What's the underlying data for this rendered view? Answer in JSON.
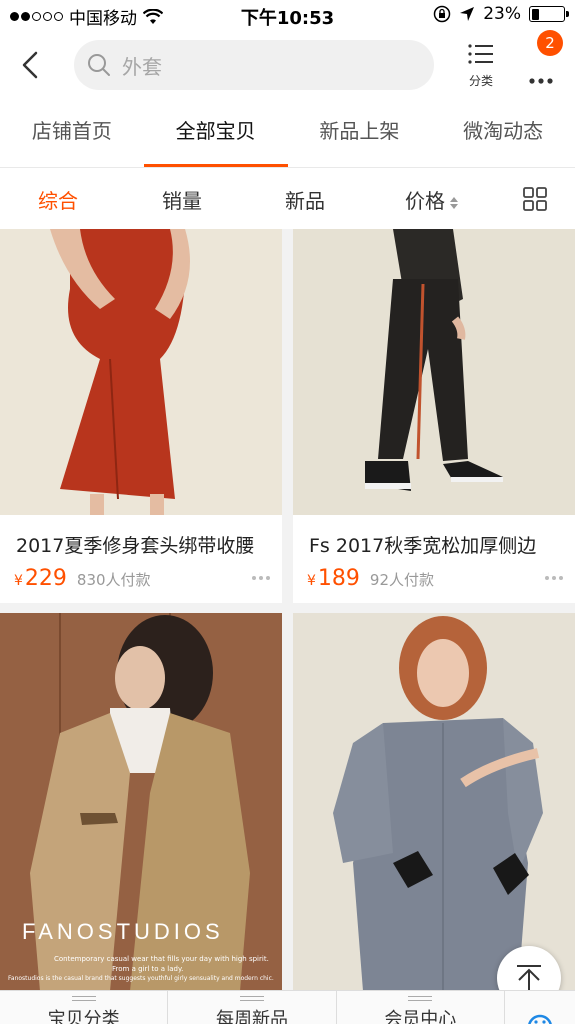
{
  "status_bar": {
    "carrier": "中国移动",
    "time": "下午10:53",
    "battery": "23%",
    "battery_level": 0.23
  },
  "navbar": {
    "search_placeholder": "外套",
    "category_label": "分类",
    "badge_count": "2"
  },
  "tabs": [
    {
      "label": "店铺首页"
    },
    {
      "label": "全部宝贝",
      "active": true
    },
    {
      "label": "新品上架"
    },
    {
      "label": "微淘动态"
    }
  ],
  "sort": {
    "composite": "综合",
    "sales": "销量",
    "new": "新品",
    "price": "价格"
  },
  "products": [
    {
      "title": "2017夏季修身套头绑带收腰",
      "currency": "¥",
      "price": "229",
      "sold": "830人付款"
    },
    {
      "title": "Fs 2017秋季宽松加厚侧边",
      "currency": "¥",
      "price": "189",
      "sold": "92人付款"
    },
    {
      "brand_text": "FANOSTUDIOS",
      "caption_1": "Contemporary casual wear that fills your day with high spirit.",
      "caption_2": "From a girl to a lady.",
      "caption_3": "Fanostudios is the casual brand that suggests youthful girly sensuality and modern chic."
    },
    {}
  ],
  "bottom_bar": [
    {
      "label": "宝贝分类"
    },
    {
      "label": "每周新品"
    },
    {
      "label": "会员中心"
    }
  ],
  "colors": {
    "accent": "#ff5000"
  }
}
